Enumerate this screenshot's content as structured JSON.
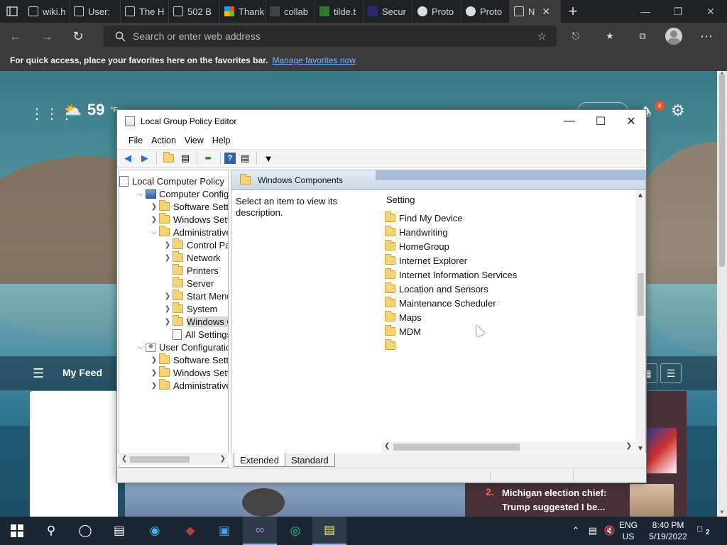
{
  "browser": {
    "tabs": [
      {
        "label": "wiki.h",
        "icon": "page-icon"
      },
      {
        "label": "User:",
        "icon": "page-icon"
      },
      {
        "label": "The H",
        "icon": "page-icon"
      },
      {
        "label": "502 B",
        "icon": "page-icon"
      },
      {
        "label": "Thank",
        "icon": "microsoft-icon"
      },
      {
        "label": "collab",
        "icon": "site-icon"
      },
      {
        "label": "tilde.t",
        "icon": "tilde-icon"
      },
      {
        "label": "Secur",
        "icon": "shield-icon"
      },
      {
        "label": "Proto",
        "icon": "user-icon"
      },
      {
        "label": "Proto",
        "icon": "user-icon"
      },
      {
        "label": "N",
        "icon": "newtab-icon",
        "active": true
      }
    ],
    "address_placeholder": "Search or enter web address",
    "favorites_bar": {
      "message": "For quick access, place your favorites here on the favorites bar.",
      "link": "Manage favorites now"
    }
  },
  "ntp": {
    "temperature": "59",
    "temp_unit": "°F",
    "notifications_count": "4",
    "feed_title": "My Feed",
    "news": {
      "rank": "2.",
      "headline": "Michigan election chief: Trump suggested I be..."
    }
  },
  "gpe": {
    "title": "Local Group Policy Editor",
    "menu": [
      "File",
      "Action",
      "View",
      "Help"
    ],
    "tree": [
      {
        "label": "Local Computer Policy",
        "depth": 0,
        "icon": "doc",
        "exp": ""
      },
      {
        "label": "Computer Configura",
        "depth": 1,
        "icon": "pc",
        "exp": "v"
      },
      {
        "label": "Software Settings",
        "depth": 2,
        "icon": "folder",
        "exp": ">"
      },
      {
        "label": "Windows Settings",
        "depth": 2,
        "icon": "folder",
        "exp": ">"
      },
      {
        "label": "Administrative Templates",
        "depth": 2,
        "icon": "folder",
        "exp": "v"
      },
      {
        "label": "Control Panel",
        "depth": 3,
        "icon": "folder",
        "exp": ">"
      },
      {
        "label": "Network",
        "depth": 3,
        "icon": "folder",
        "exp": ">"
      },
      {
        "label": "Printers",
        "depth": 3,
        "icon": "folder",
        "exp": ""
      },
      {
        "label": "Server",
        "depth": 3,
        "icon": "folder",
        "exp": ""
      },
      {
        "label": "Start Menu and Taskbar",
        "depth": 3,
        "icon": "folder",
        "exp": ">"
      },
      {
        "label": "System",
        "depth": 3,
        "icon": "folder",
        "exp": ">"
      },
      {
        "label": "Windows Components",
        "depth": 3,
        "icon": "folder",
        "exp": ">",
        "selected": true
      },
      {
        "label": "All Settings",
        "depth": 3,
        "icon": "doc",
        "exp": ""
      },
      {
        "label": "User Configuration",
        "depth": 1,
        "icon": "user",
        "exp": "v"
      },
      {
        "label": "Software Settings",
        "depth": 2,
        "icon": "folder",
        "exp": ">"
      },
      {
        "label": "Windows Settings",
        "depth": 2,
        "icon": "folder",
        "exp": ">"
      },
      {
        "label": "Administrative Templates",
        "depth": 2,
        "icon": "folder",
        "exp": ">"
      }
    ],
    "pane_header": "Windows Components",
    "description": "Select an item to view its description.",
    "column_header": "Setting",
    "settings": [
      "Find My Device",
      "Handwriting",
      "HomeGroup",
      "Internet Explorer",
      "Internet Information Services",
      "Location and Sensors",
      "Maintenance Scheduler",
      "Maps",
      "MDM",
      ""
    ],
    "view_tabs": [
      "Extended",
      "Standard"
    ]
  },
  "taskbar": {
    "lang_top": "ENG",
    "lang_bottom": "US",
    "time": "8:40 PM",
    "date": "5/19/2022",
    "notif_count": "2"
  },
  "colors": {
    "chrome_dark": "#202124",
    "chrome_mid": "#3b3b3b",
    "link_blue": "#7ab4ff",
    "taskbar": "#1b2633",
    "badge_orange": "#e8562a"
  }
}
